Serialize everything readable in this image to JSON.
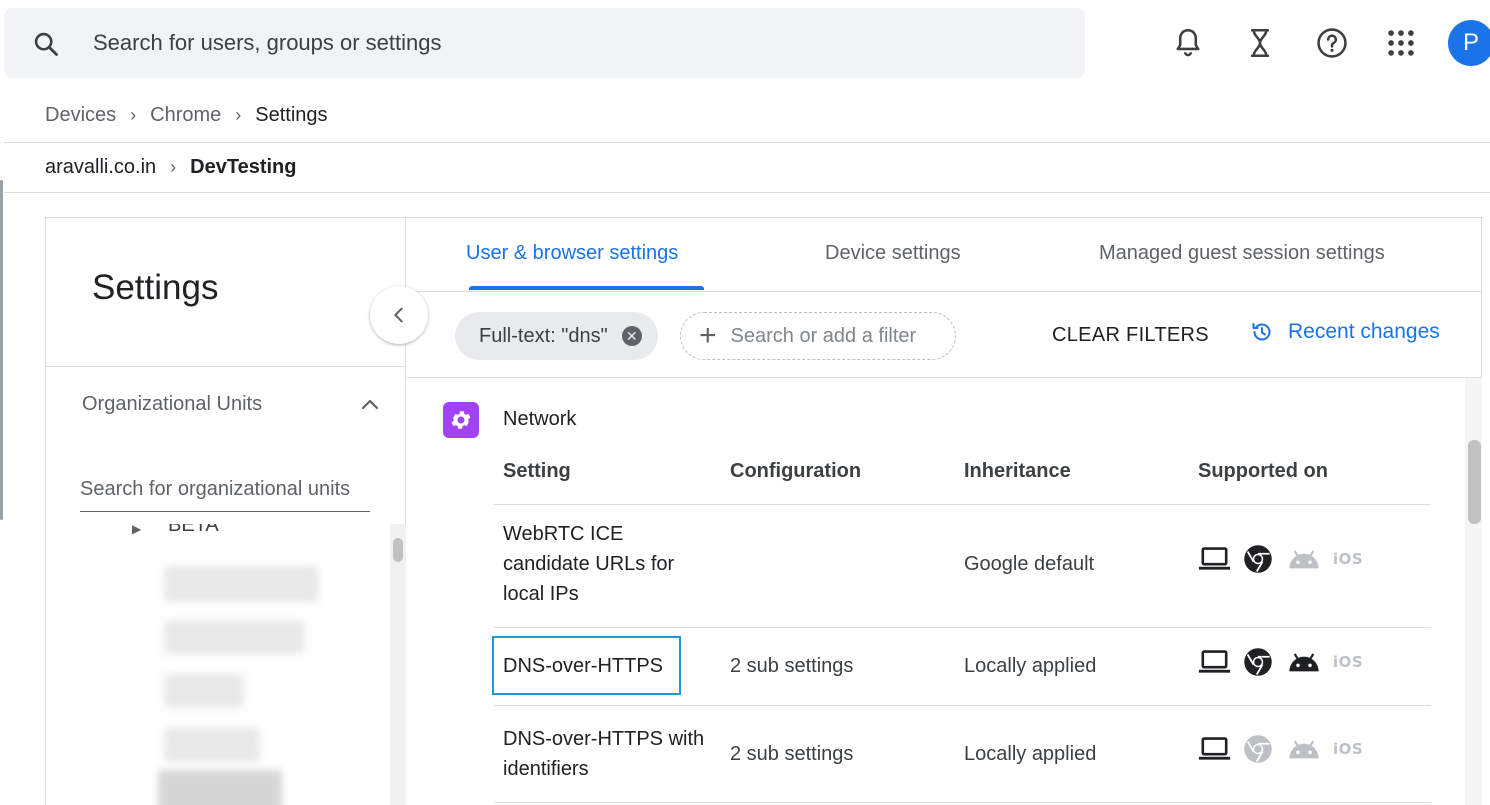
{
  "search": {
    "placeholder": "Search for users, groups or settings"
  },
  "header_icons": [
    "bell-icon",
    "hourglass-icon",
    "help-icon",
    "apps-grid-icon"
  ],
  "user": {
    "avatar_letter": "P",
    "avatar_color": "#1a73e8"
  },
  "breadcrumb": {
    "items": [
      "Devices",
      "Chrome"
    ],
    "current": "Settings"
  },
  "ou_path": {
    "root": "aravalli.co.in",
    "current": "DevTesting"
  },
  "left_panel": {
    "title": "Settings",
    "ou_heading": "Organizational Units",
    "ou_search_placeholder": "Search for organizational units",
    "ou_items": [
      "BETA"
    ]
  },
  "tabs": {
    "items": [
      "User & browser settings",
      "Device settings",
      "Managed guest session settings"
    ],
    "active": "User & browser settings"
  },
  "filters": {
    "chip_label": "Full-text: \"dns\"",
    "add_placeholder": "Search or add a filter",
    "clear_label": "CLEAR FILTERS",
    "recent_label": "Recent changes"
  },
  "section": {
    "title": "Network",
    "icon": "settings-gear-icon",
    "icon_color": "#a142f4"
  },
  "table": {
    "headers": {
      "setting": "Setting",
      "configuration": "Configuration",
      "inheritance": "Inheritance",
      "supported": "Supported on"
    },
    "rows": [
      {
        "setting_lines": [
          "WebRTC ICE",
          "candidate URLs for",
          "local IPs"
        ],
        "configuration": "",
        "inheritance": "Google default",
        "platforms": {
          "windows": true,
          "chrome": true,
          "android": false,
          "ios": false
        }
      },
      {
        "setting_lines": [
          "DNS-over-HTTPS"
        ],
        "configuration": "2 sub settings",
        "inheritance": "Locally applied",
        "platforms": {
          "windows": true,
          "chrome": true,
          "android": true,
          "ios": false
        }
      },
      {
        "setting_lines": [
          "DNS-over-HTTPS with",
          "identifiers"
        ],
        "configuration": "2 sub settings",
        "inheritance": "Locally applied",
        "platforms": {
          "windows": true,
          "chrome": false,
          "android": false,
          "ios": false
        }
      }
    ],
    "ios_label": "iOS"
  },
  "colors": {
    "accent": "#1a73e8",
    "platform_on": "#202124",
    "platform_off": "#bdc1c6",
    "highlight_border": "#1a9bd7"
  }
}
